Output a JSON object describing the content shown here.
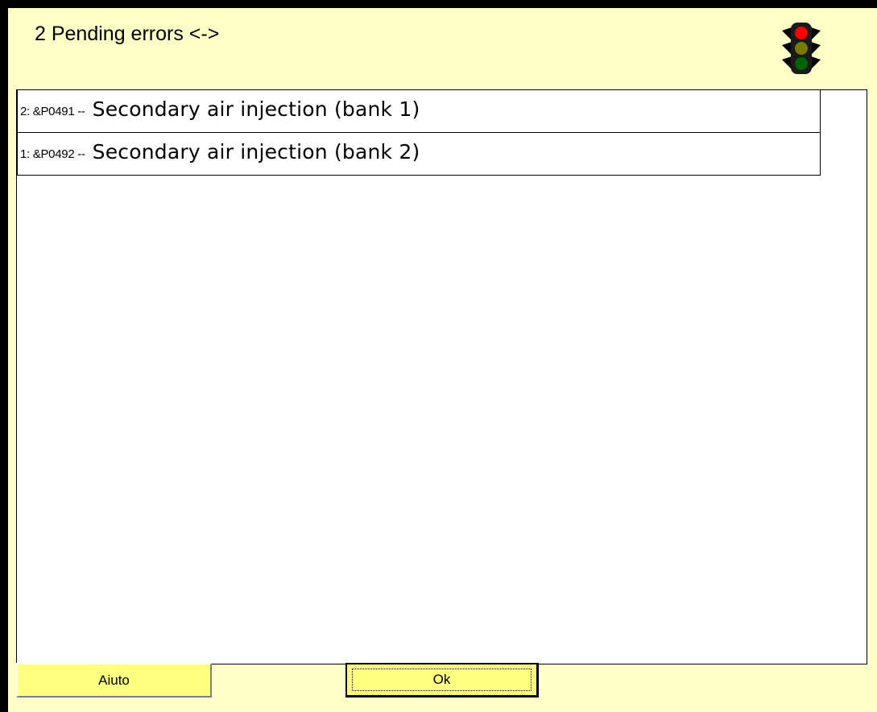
{
  "header": {
    "title": "2 Pending errors <->",
    "status_icon": "traffic-light-icon",
    "status_lights": [
      "#ff0000",
      "#7a7a00",
      "#006400"
    ]
  },
  "errors": [
    {
      "prefix": "2: &P0491 --",
      "description": "Secondary air injection (bank 1)"
    },
    {
      "prefix": "1: &P0492 --",
      "description": "Secondary air injection (bank 2)"
    }
  ],
  "buttons": {
    "help_label": "Aiuto",
    "ok_label": "Ok"
  },
  "colors": {
    "panel_background": "#ffffc8",
    "button_background": "#ffff80",
    "list_background": "#ffffff",
    "frame": "#000000"
  }
}
